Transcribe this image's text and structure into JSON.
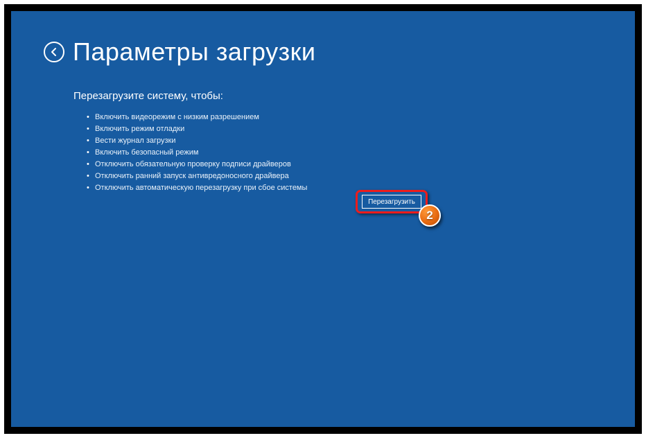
{
  "title": "Параметры загрузки",
  "subtitle": "Перезагрузите систему, чтобы:",
  "options": [
    "Включить видеорежим с низким разрешением",
    "Включить режим отладки",
    "Вести журнал загрузки",
    "Включить безопасный режим",
    "Отключить обязательную проверку подписи драйверов",
    "Отключить ранний запуск антивредоносного драйвера",
    "Отключить автоматическую перезагрузку при сбое системы"
  ],
  "restart_button": "Перезагрузить",
  "annotation_badge": "2"
}
